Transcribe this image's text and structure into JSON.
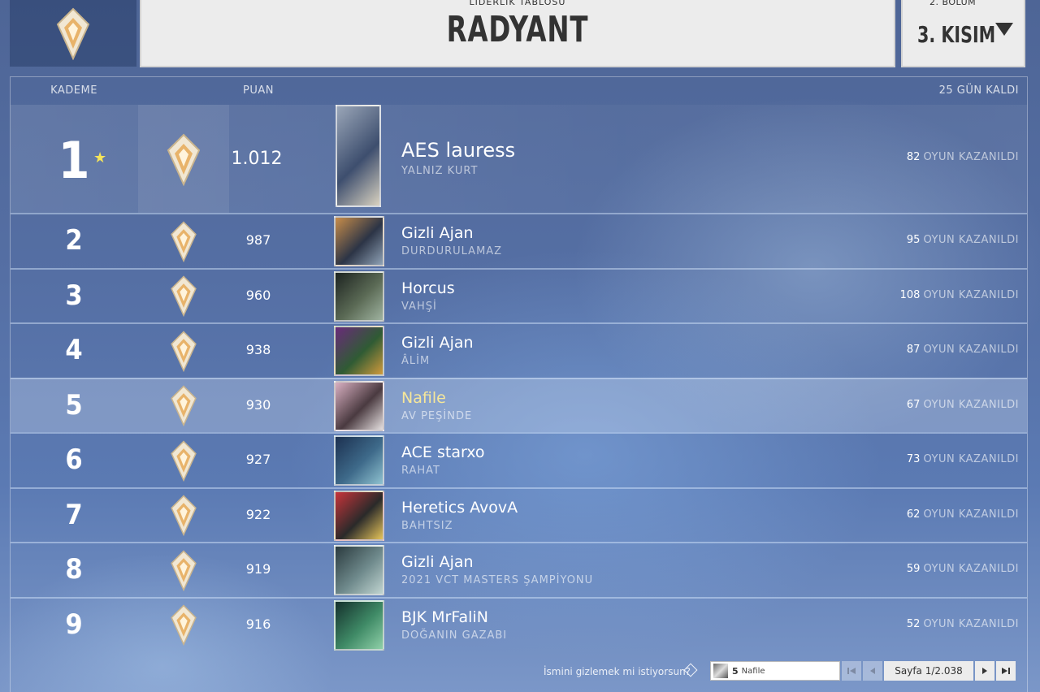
{
  "header": {
    "section_label": "LİDERLİK TABLOSU",
    "title": "RADYANT",
    "episode_label": "2. BÖLÜM",
    "act_label": "3. KISIM"
  },
  "table_header": {
    "tier": "KADEME",
    "points": "PUAN",
    "days_left": "25 GÜN KALDI"
  },
  "wins_suffix": "OYUN KAZANILDI",
  "rows": [
    {
      "rank": "1",
      "points": "1.012",
      "name": "AES lauress",
      "title": "YALNIZ KURT",
      "wins": "82"
    },
    {
      "rank": "2",
      "points": "987",
      "name": "Gizli Ajan",
      "title": "DURDURULAMAZ",
      "wins": "95"
    },
    {
      "rank": "3",
      "points": "960",
      "name": "Horcus",
      "title": "VAHŞİ",
      "wins": "108"
    },
    {
      "rank": "4",
      "points": "938",
      "name": "Gizli Ajan",
      "title": "ÂLİM",
      "wins": "87"
    },
    {
      "rank": "5",
      "points": "930",
      "name": "Nafile",
      "title": "AV PEŞİNDE",
      "wins": "67"
    },
    {
      "rank": "6",
      "points": "927",
      "name": "ACE starxo",
      "title": "RAHAT",
      "wins": "73"
    },
    {
      "rank": "7",
      "points": "922",
      "name": "Heretics AvovA",
      "title": "BAHTSIZ",
      "wins": "62"
    },
    {
      "rank": "8",
      "points": "919",
      "name": "Gizli Ajan",
      "title": "2021 VCT MASTERS ŞAMPİYONU",
      "wins": "59"
    },
    {
      "rank": "9",
      "points": "916",
      "name": "BJK MrFaliN",
      "title": "DOĞANIN GAZABI",
      "wins": "52"
    }
  ],
  "footer": {
    "hide_question": "İsmini gizlemek mi istiyorsun?",
    "search_rank": "5",
    "search_name": "Nafile",
    "page_label": "Sayfa 1/2.038"
  },
  "colors": {
    "highlight_name": "#f6e79a",
    "star": "#f5e45a",
    "panel_bg": "#ececec"
  },
  "icons": {
    "rank": "radiant-rank-icon",
    "star": "star-icon",
    "hide": "diamond-icon",
    "first": "first-page-icon",
    "prev": "prev-page-icon",
    "next": "next-page-icon",
    "last": "last-page-icon"
  }
}
